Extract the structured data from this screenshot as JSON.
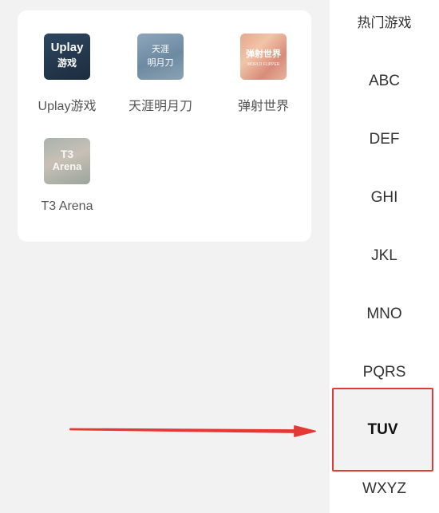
{
  "games": [
    {
      "label": "Uplay游戏",
      "icon": "uplay-game-icon",
      "icon_text": [
        "Uplay",
        "游戏"
      ]
    },
    {
      "label": "天涯明月刀",
      "icon": "tianya-mingyuedao-icon",
      "icon_text": [
        "天涯",
        "明月刀"
      ]
    },
    {
      "label": "弹射世界",
      "icon": "danshe-shijie-icon",
      "icon_text": [
        "弹射世界",
        "WORLD FLIPPER"
      ]
    },
    {
      "label": "T3 Arena",
      "icon": "t3-arena-icon",
      "icon_text": [
        "T3",
        "Arena"
      ]
    }
  ],
  "sidebar": {
    "items": [
      {
        "label": "热门游戏"
      },
      {
        "label": "ABC"
      },
      {
        "label": "DEF"
      },
      {
        "label": "GHI"
      },
      {
        "label": "JKL"
      },
      {
        "label": "MNO"
      },
      {
        "label": "PQRS"
      },
      {
        "label": "TUV",
        "selected": true
      },
      {
        "label": "WXYZ"
      }
    ]
  },
  "annotation": {
    "type": "arrow",
    "target": "TUV",
    "color": "#e53935"
  },
  "colors": {
    "highlight_border": "#e53935",
    "background": "#f2f2f2",
    "card": "#ffffff"
  }
}
